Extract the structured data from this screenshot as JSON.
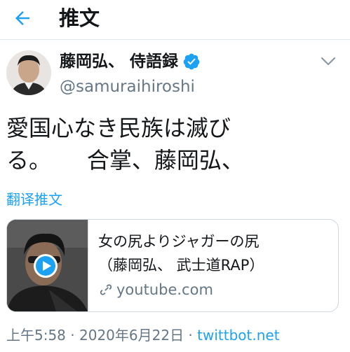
{
  "header": {
    "title": "推文",
    "back_icon": "arrow-left-icon"
  },
  "tweet": {
    "author": {
      "display_name": "藤岡弘、 侍語録",
      "handle": "@samuraihiroshi",
      "verified_icon": "verified-badge-icon",
      "verified_color": "#1da1f2"
    },
    "menu_icon": "chevron-down-icon",
    "text_line1": "愛国心なき民族は滅び",
    "text_line2": "る。     合掌、藤岡弘、",
    "translate_label": "翻译推文",
    "card": {
      "title_line1": "女の尻よりジャガーの尻",
      "title_line2": "（藤岡弘、 武士道RAP）",
      "link_icon": "link-icon",
      "play_icon": "play-icon",
      "domain": "youtube.com"
    },
    "time": "上午5:58",
    "separator": " · ",
    "date": "2020年6月22日",
    "source": "twittbot.net"
  },
  "colors": {
    "accent": "#1da1f2",
    "secondary_text": "#657786",
    "border": "#cfd9de"
  }
}
